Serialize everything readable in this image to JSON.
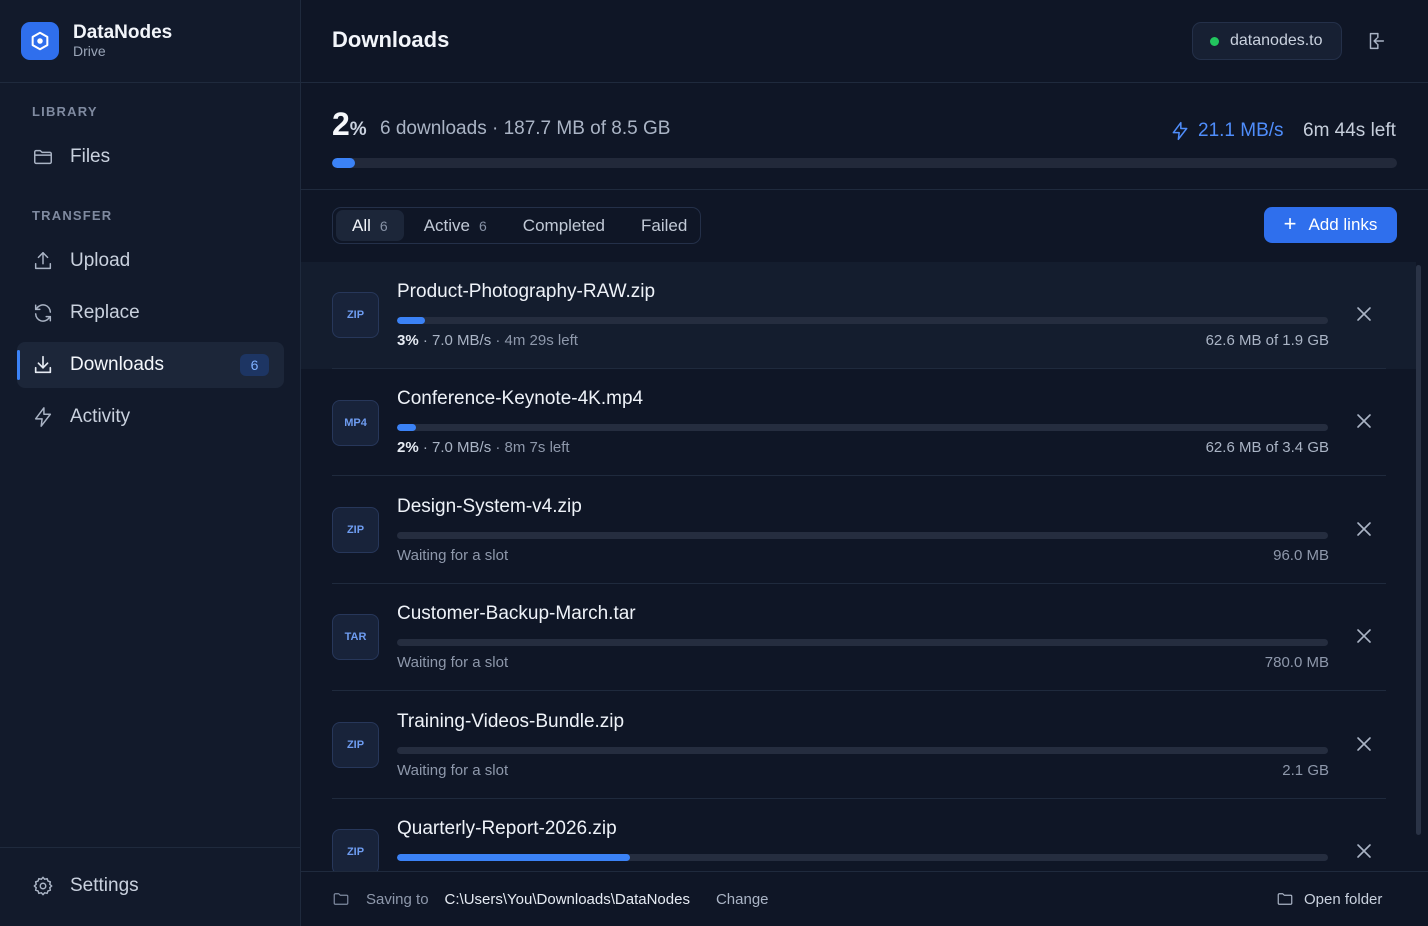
{
  "brand": {
    "name": "DataNodes",
    "subtitle": "Drive"
  },
  "sidebar": {
    "library_label": "LIBRARY",
    "transfer_label": "TRANSFER",
    "items": [
      {
        "label": "Files",
        "icon": "folder-icon"
      },
      {
        "label": "Upload",
        "icon": "upload-icon"
      },
      {
        "label": "Replace",
        "icon": "refresh-icon"
      },
      {
        "label": "Downloads",
        "icon": "download-icon",
        "badge": "6",
        "active": true
      },
      {
        "label": "Activity",
        "icon": "bolt-icon"
      }
    ],
    "settings_label": "Settings"
  },
  "header": {
    "title": "Downloads",
    "host": "datanodes.to"
  },
  "summary": {
    "percent": "2",
    "percent_sign": "%",
    "text": "6 downloads · 187.7 MB of 8.5 GB",
    "speed": "21.1 MB/s",
    "time_left": "6m 44s left",
    "progress": 0.022
  },
  "tabs": [
    {
      "label": "All",
      "count": "6",
      "active": true
    },
    {
      "label": "Active",
      "count": "6"
    },
    {
      "label": "Completed",
      "count": ""
    },
    {
      "label": "Failed",
      "count": ""
    }
  ],
  "add_button_label": "Add links",
  "downloads": [
    {
      "type": "ZIP",
      "name": "Product-Photography-RAW.zip",
      "progress": 0.03,
      "pct": "3%",
      "detail": " · 7.0 MB/s",
      "eta": " · 4m 29s left",
      "size": "62.6 MB of 1.9 GB"
    },
    {
      "type": "MP4",
      "name": "Conference-Keynote-4K.mp4",
      "progress": 0.02,
      "pct": "2%",
      "detail": " · 7.0 MB/s",
      "eta": " · 8m 7s left",
      "size": "62.6 MB of 3.4 GB"
    },
    {
      "type": "ZIP",
      "name": "Design-System-v4.zip",
      "progress": 0,
      "status": "Waiting for a slot",
      "size": "96.0 MB"
    },
    {
      "type": "TAR",
      "name": "Customer-Backup-March.tar",
      "progress": 0,
      "status": "Waiting for a slot",
      "size": "780.0 MB"
    },
    {
      "type": "ZIP",
      "name": "Training-Videos-Bundle.zip",
      "progress": 0,
      "status": "Waiting for a slot",
      "size": "2.1 GB"
    },
    {
      "type": "ZIP",
      "name": "Quarterly-Report-2026.zip",
      "progress": 0.25,
      "status": "",
      "size": ""
    }
  ],
  "footer": {
    "saving_label": "Saving to",
    "path": "C:\\Users\\You\\Downloads\\DataNodes",
    "change_label": "Change",
    "open_folder_label": "Open folder"
  },
  "colors": {
    "accent": "#3b82f6",
    "status_ok": "#22c55e",
    "background": "#0f1626"
  }
}
